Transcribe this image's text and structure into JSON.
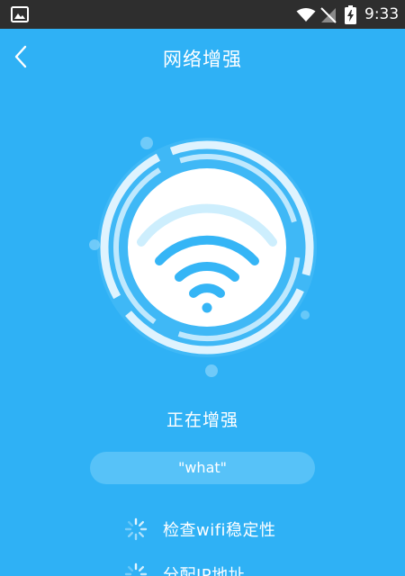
{
  "status_bar": {
    "time": "9:33",
    "icons": [
      "gallery-icon",
      "wifi-icon",
      "signal-icon",
      "battery-charging-icon"
    ]
  },
  "header": {
    "title": "网络增强",
    "back_icon": "chevron-left-icon"
  },
  "hero": {
    "icon": "wifi-icon"
  },
  "status": {
    "text": "正在增强"
  },
  "network": {
    "ssid": "\"what\""
  },
  "tasks": [
    {
      "label": "检查wifi稳定性",
      "icon": "loading-spinner-icon"
    },
    {
      "label": "分配IP地址",
      "icon": "loading-spinner-icon"
    }
  ],
  "colors": {
    "background": "#2fb1f5",
    "status_bar": "#2e2e2e",
    "pill": "#57c2f8",
    "wifi_glyph": "#35b5f6",
    "ring": "#dff3fe"
  }
}
